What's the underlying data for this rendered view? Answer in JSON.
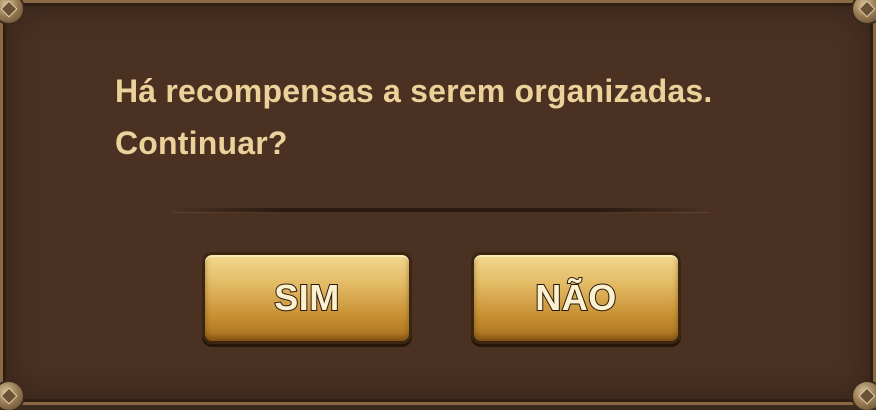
{
  "dialog": {
    "message_line1": "Há recompensas a serem organizadas.",
    "message_line2": "Continuar?",
    "yes_label": "SIM",
    "no_label": "NÃO"
  },
  "colors": {
    "panel_background": "#4a3122",
    "frame": "#8a6a43",
    "message_text": "#ecd29a",
    "button_gold": "#e2b963",
    "button_text": "#fbf0cf"
  },
  "icons": [
    "corner-ornament-icon"
  ]
}
